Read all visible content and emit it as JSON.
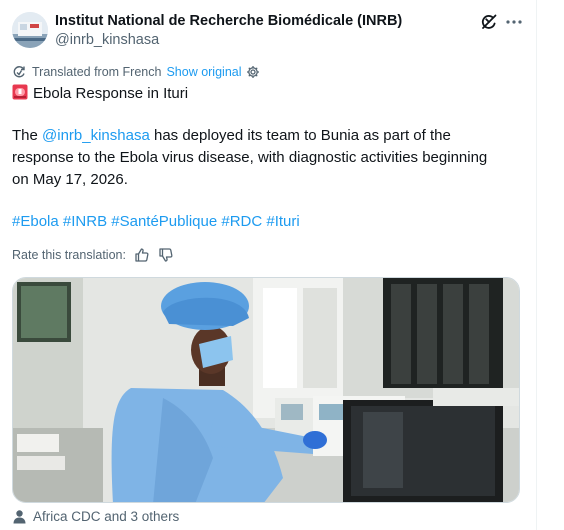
{
  "author": {
    "name": "Institut National de Recherche Biomédicale (INRB)",
    "handle": "@inrb_kinshasa"
  },
  "translation": {
    "notice": "Translated from French",
    "show_original": "Show original"
  },
  "post": {
    "title": "Ebola Response in Ituri",
    "line1_before": "The ",
    "mention": "@inrb_kinshasa",
    "line1_after": " has deployed its team to Bunia as part of the",
    "line2": "response to the Ebola virus disease, with diagnostic activities beginning",
    "line3": "on May 17, 2026.",
    "hashtags": [
      "#Ebola",
      "#INRB",
      "#SantéPublique",
      "#RDC",
      "#Ituri"
    ]
  },
  "rate": {
    "label": "Rate this translation:"
  },
  "tagged": {
    "text": "Africa CDC and 3 others"
  },
  "colors": {
    "accent": "#1d9bf0",
    "secondary_text": "#536471",
    "primary_text": "#0f1419",
    "gown": "#7fb4e6",
    "cap": "#5aa0e0"
  },
  "icons": [
    "grok-icon",
    "more-icon",
    "translate-icon",
    "settings-icon",
    "siren-emoji",
    "thumbs-up-icon",
    "thumbs-down-icon",
    "person-icon"
  ]
}
